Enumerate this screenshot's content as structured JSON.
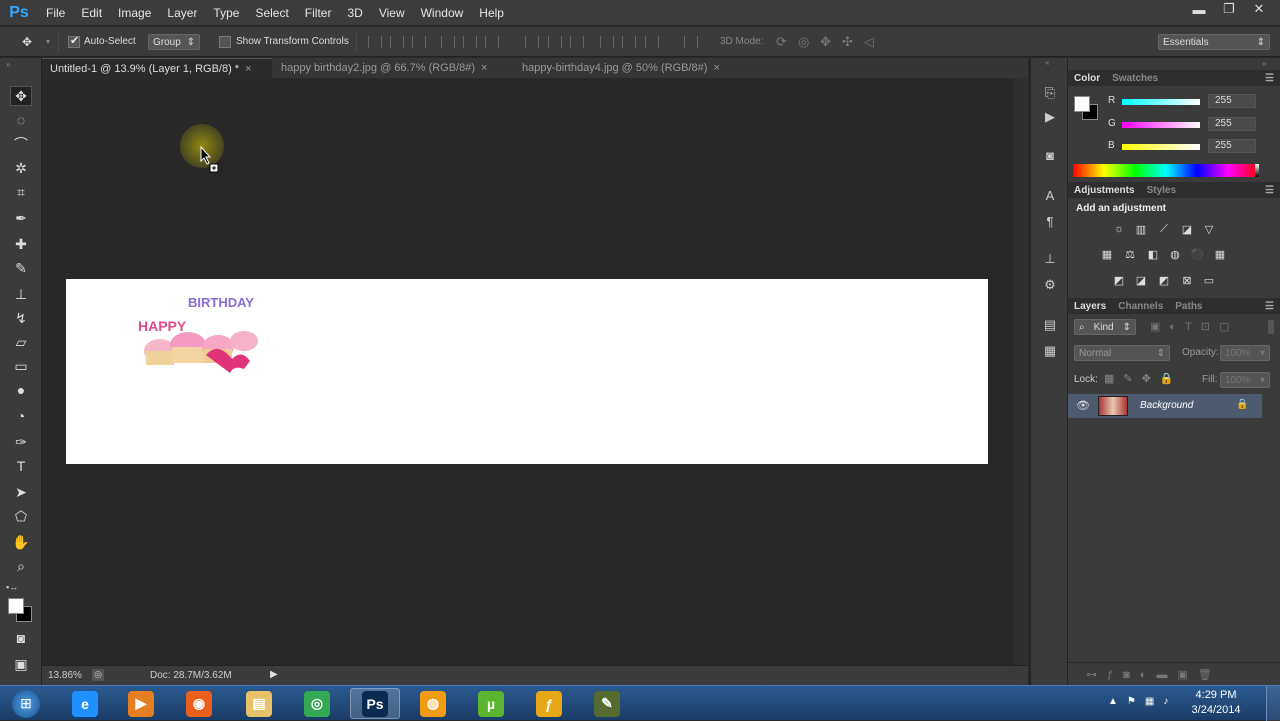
{
  "app": {
    "logo": "Ps"
  },
  "menu": [
    "File",
    "Edit",
    "Image",
    "Layer",
    "Type",
    "Select",
    "Filter",
    "3D",
    "View",
    "Window",
    "Help"
  ],
  "window_controls": {
    "minimize": "▬",
    "restore": "❐",
    "close": "✕"
  },
  "options": {
    "auto_select_label": "Auto-Select",
    "auto_select_checked": true,
    "auto_select_mode": "Group",
    "show_transform_label": "Show Transform Controls",
    "mode_3d_label": "3D Mode:",
    "workspace": "Essentials"
  },
  "tabs": [
    {
      "label": "Untitled-1 @ 13.9% (Layer 1, RGB/8) *",
      "active": true
    },
    {
      "label": "happy birthday2.jpg @ 66.7% (RGB/8#)",
      "active": false
    },
    {
      "label": "happy-birthday4.jpg @ 50% (RGB/8#)",
      "active": false
    }
  ],
  "status": {
    "zoom": "13.86%",
    "doc": "Doc: 28.7M/3.62M"
  },
  "color_panel": {
    "tabs": [
      "Color",
      "Swatches"
    ],
    "channels": [
      {
        "label": "R",
        "value": "255",
        "color": "#00ffff"
      },
      {
        "label": "G",
        "value": "255",
        "color": "#ff00ff"
      },
      {
        "label": "B",
        "value": "255",
        "color": "#ffff00"
      }
    ]
  },
  "adjustments_panel": {
    "tabs": [
      "Adjustments",
      "Styles"
    ],
    "heading": "Add an adjustment"
  },
  "layers_panel": {
    "tabs": [
      "Layers",
      "Channels",
      "Paths"
    ],
    "filter_kind": "Kind",
    "blend_mode": "Normal",
    "opacity_label": "Opacity:",
    "opacity_value": "100%",
    "lock_label": "Lock:",
    "fill_label": "Fill:",
    "fill_value": "100%",
    "layers": [
      {
        "name": "Background",
        "visible": true,
        "locked": true
      }
    ]
  },
  "canvas_image": {
    "line1": "BIRTHDAY",
    "line2": "HAPPY"
  },
  "taskbar": {
    "clock_time": "4:29 PM",
    "clock_date": "3/24/2014",
    "apps": [
      {
        "name": "internet-explorer",
        "glyph": "e",
        "color": "#1e90ff"
      },
      {
        "name": "media-player",
        "glyph": "▶",
        "color": "#e67e22"
      },
      {
        "name": "firefox",
        "glyph": "◉",
        "color": "#e8601c"
      },
      {
        "name": "file-explorer",
        "glyph": "▤",
        "color": "#e8c16b"
      },
      {
        "name": "chrome",
        "glyph": "◎",
        "color": "#34a853"
      },
      {
        "name": "photoshop",
        "glyph": "Ps",
        "color": "#0a2a52"
      },
      {
        "name": "vlc-like",
        "glyph": "◍",
        "color": "#f39c12"
      },
      {
        "name": "utorrent",
        "glyph": "µ",
        "color": "#5cb531"
      },
      {
        "name": "fl-studio",
        "glyph": "ƒ",
        "color": "#e6a817"
      },
      {
        "name": "dreamweaver",
        "glyph": "✎",
        "color": "#556b2f"
      }
    ]
  }
}
